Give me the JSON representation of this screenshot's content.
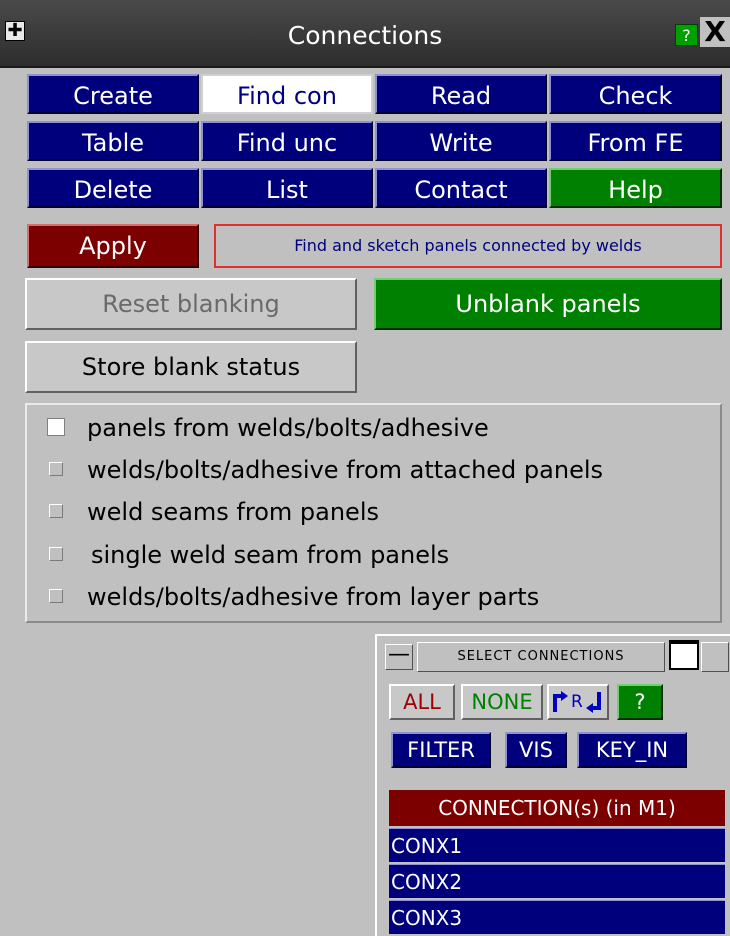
{
  "window": {
    "title": "Connections",
    "help_label": "?",
    "close_label": "X",
    "corner_icon": "✚"
  },
  "toolbar": {
    "buttons": [
      {
        "label": "Create",
        "state": "normal"
      },
      {
        "label": "Find con",
        "state": "selected"
      },
      {
        "label": "Read",
        "state": "normal"
      },
      {
        "label": "Check",
        "state": "normal"
      },
      {
        "label": "Table",
        "state": "normal"
      },
      {
        "label": "Find unc",
        "state": "normal"
      },
      {
        "label": "Write",
        "state": "normal"
      },
      {
        "label": "From FE",
        "state": "normal"
      },
      {
        "label": "Delete",
        "state": "normal"
      },
      {
        "label": "List",
        "state": "normal"
      },
      {
        "label": "Contact",
        "state": "normal"
      },
      {
        "label": "Help",
        "state": "green"
      }
    ]
  },
  "action": {
    "apply_label": "Apply",
    "hint": "Find and sketch panels connected by welds"
  },
  "blanking": {
    "reset_label": "Reset blanking",
    "unblank_label": "Unblank panels",
    "store_label": "Store blank status"
  },
  "options": [
    {
      "label": "panels from welds/bolts/adhesive",
      "checked": true
    },
    {
      "label": "welds/bolts/adhesive from attached panels",
      "checked": false
    },
    {
      "label": "weld seams from panels",
      "checked": false
    },
    {
      "label": "single weld seam from panels",
      "checked": false
    },
    {
      "label": "welds/bolts/adhesive from layer parts",
      "checked": false
    }
  ],
  "select_panel": {
    "title": "SELECT CONNECTIONS",
    "minimize_label": "—",
    "all_label": "ALL",
    "none_label": "NONE",
    "reverse_label": "R",
    "help_label": "?",
    "filter_label": "FILTER",
    "vis_label": "VIS",
    "keyin_label": "KEY_IN",
    "list_header": "CONNECTION(s) (in M1)",
    "items": [
      "CONX1",
      "CONX2",
      "CONX3"
    ]
  },
  "colors": {
    "button_blue": "#00007c",
    "green": "#008000",
    "dark_red": "#7c0000",
    "panel_gray": "#c0c0c0"
  }
}
